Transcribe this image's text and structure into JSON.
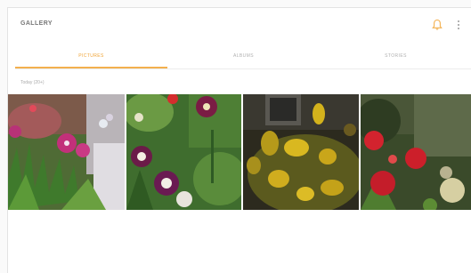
{
  "appbar": {
    "title": "GALLERY",
    "icons": [
      "bell-icon",
      "more-options-icon"
    ],
    "accent_color": "#f3b04e"
  },
  "tabs": [
    {
      "label": "PICTURES",
      "active": true
    },
    {
      "label": "ALBUMS",
      "active": false
    },
    {
      "label": "STORIES",
      "active": false
    }
  ],
  "section": {
    "date_label": "Today (20+)"
  },
  "photos": [
    {
      "subject": "pink flowers photo"
    },
    {
      "subject": "purple columbine flowers photo"
    },
    {
      "subject": "yellow flowering shrub photo"
    },
    {
      "subject": "red flowers photo"
    }
  ]
}
